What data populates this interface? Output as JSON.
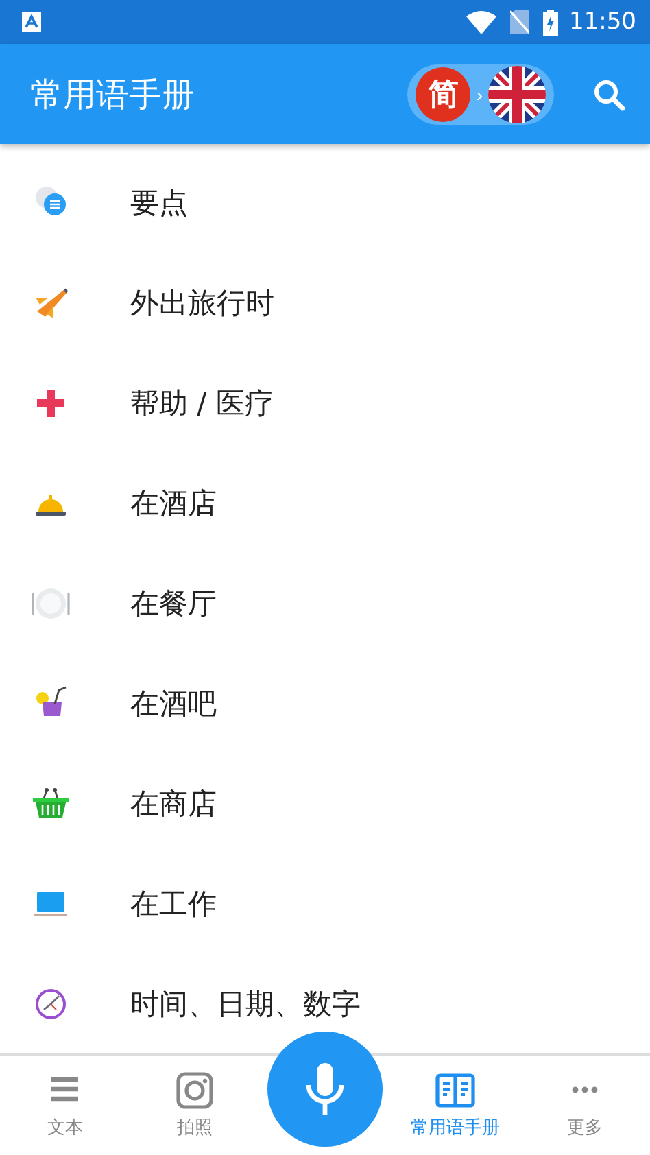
{
  "status_bar": {
    "time": "11:50"
  },
  "app_bar": {
    "title": "常用语手册",
    "source_language": "简",
    "arrow": "›"
  },
  "categories": [
    {
      "label": "要点"
    },
    {
      "label": "外出旅行时"
    },
    {
      "label": "帮助 / 医疗"
    },
    {
      "label": "在酒店"
    },
    {
      "label": "在餐厅"
    },
    {
      "label": "在酒吧"
    },
    {
      "label": "在商店"
    },
    {
      "label": "在工作"
    },
    {
      "label": "时间、日期、数字"
    }
  ],
  "bottom_nav": [
    {
      "kind": "tab",
      "label": "文本",
      "selected": false
    },
    {
      "kind": "tab",
      "label": "拍照",
      "selected": false
    },
    {
      "kind": "mic"
    },
    {
      "kind": "tab",
      "label": "常用语手册",
      "selected": true
    },
    {
      "kind": "tab",
      "label": "更多",
      "selected": false
    }
  ]
}
